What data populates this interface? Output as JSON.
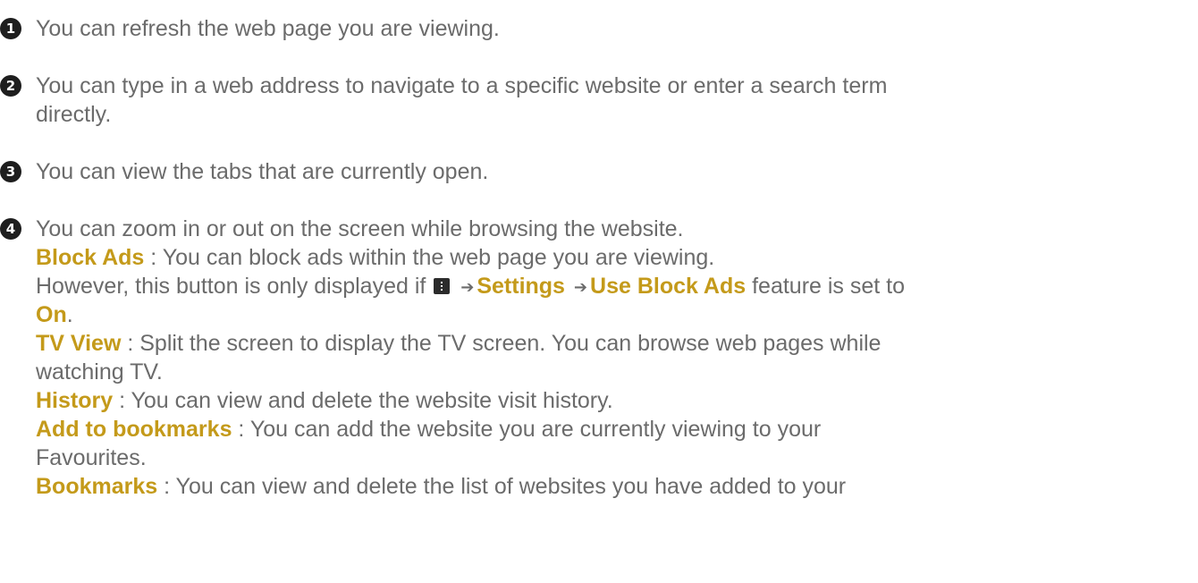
{
  "items": [
    {
      "num": "1",
      "text": "You can refresh the web page you are viewing."
    },
    {
      "num": "2",
      "text": "You can type in a web address to navigate to a specific website or enter a search term",
      "text2": "directly."
    },
    {
      "num": "3",
      "text": "You can view the tabs that are currently open."
    },
    {
      "num": "4",
      "text": "You can zoom in or out on the screen while browsing the website."
    }
  ],
  "block_ads": {
    "label": "Block Ads",
    "desc": " : You can block ads within the web page you are viewing.",
    "note_start": "However, this button is only displayed if",
    "arrow": "➔",
    "settings_label": "Settings",
    "use_block_ads_label": "Use Block Ads",
    "note_mid": " feature is set to",
    "on_label": "On",
    "note_end": ".",
    "menu_icon": "more-menu-icon"
  },
  "tv_view": {
    "label": "TV View",
    "desc": " : Split the screen to display the TV screen. You can browse web pages while",
    "desc2": "watching TV."
  },
  "history": {
    "label": "History",
    "desc": " : You can view and delete the website visit history."
  },
  "add_bookmark": {
    "label": "Add to bookmarks",
    "desc": " : You can add the website you are currently viewing to your",
    "desc2": "Favourites."
  },
  "bookmarks": {
    "label": "Bookmarks",
    "desc": " : You can view and delete the list of websites you have added to your"
  },
  "colors": {
    "text": "#6b6b6b",
    "highlight": "#c49a1a",
    "badge": "#1e1e1e"
  }
}
